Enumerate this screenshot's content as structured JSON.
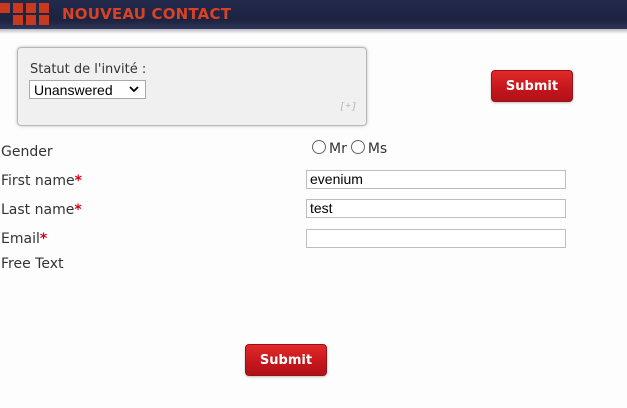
{
  "header": {
    "title": "NOUVEAU CONTACT"
  },
  "status_panel": {
    "label": "Statut de l'invité :",
    "selected": "Unanswered",
    "expand_label": "[+]"
  },
  "top_submit": {
    "label": "Submit"
  },
  "form": {
    "gender": {
      "label": "Gender",
      "options": [
        "Mr",
        "Ms"
      ]
    },
    "first_name": {
      "label": "First name",
      "required_mark": "*",
      "value": "evenium"
    },
    "last_name": {
      "label": "Last name",
      "required_mark": "*",
      "value": "test"
    },
    "email": {
      "label": "Email",
      "required_mark": "*",
      "value": ""
    },
    "free_text": {
      "label": "Free Text"
    }
  },
  "bottom_submit": {
    "label": "Submit"
  },
  "colors": {
    "header_bg": "#1c2340",
    "header_text": "#d94225",
    "button_red": "#c4161c",
    "required": "#d0021b"
  }
}
